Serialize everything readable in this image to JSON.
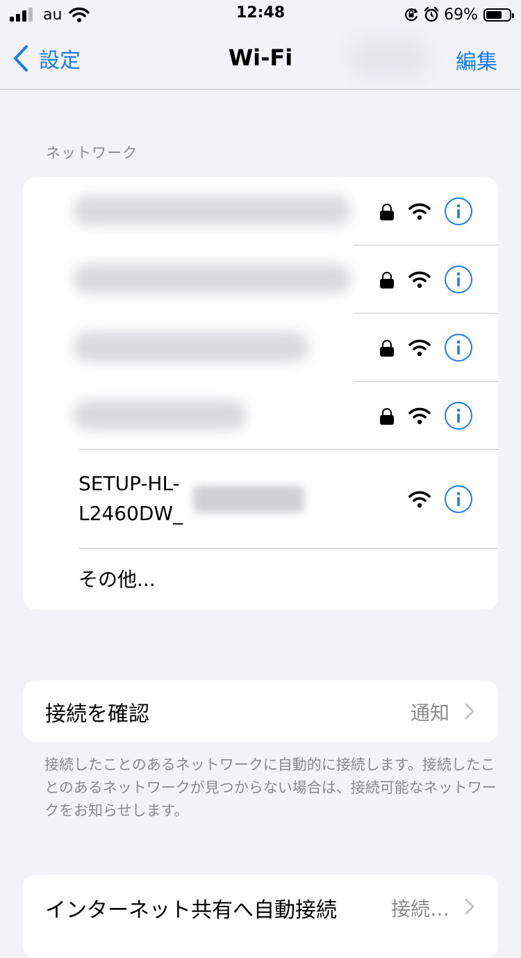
{
  "status_bar": {
    "carrier": "au",
    "time": "12:48",
    "battery_percent": "69%",
    "battery_level": 0.69,
    "signal_bars": 3
  },
  "nav": {
    "back_label": "設定",
    "title": "Wi-Fi",
    "edit_label": "編集"
  },
  "networks": {
    "section_header": "ネットワーク",
    "hidden_count": 4,
    "setup_network": {
      "line1": "SETUP-HL-",
      "line2": "L2460DW_"
    },
    "other_label": "その他..."
  },
  "ask_join": {
    "label": "接続を確認",
    "value": "通知",
    "footer": "接続したことのあるネットワークに自動的に接続します。接続したことのあるネットワークが見つからない場合は、接続可能なネットワークをお知らせします。"
  },
  "auto_hotspot": {
    "label": "インターネット共有へ自動接続",
    "value": "接続…"
  },
  "colors": {
    "accent": "#1a7cf2",
    "background": "#f2f2f7",
    "card": "#ffffff",
    "secondary_text": "#8a8a8e"
  },
  "icons": [
    "wifi-icon",
    "lock-icon",
    "info-icon",
    "chevron-right-icon",
    "chevron-left-icon",
    "alarm-icon",
    "rotation-lock-icon",
    "battery-icon",
    "signal-icon"
  ]
}
